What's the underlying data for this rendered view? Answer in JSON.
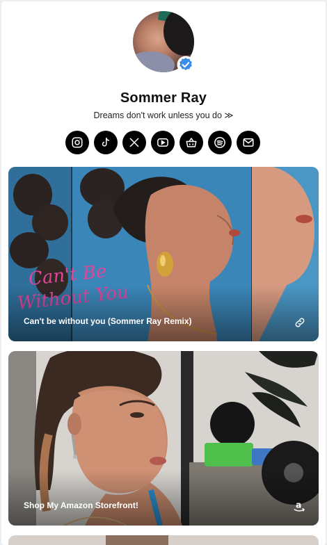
{
  "profile": {
    "name": "Sommer Ray",
    "bio": "Dreams don't work unless you do ≫"
  },
  "socials": [
    {
      "icon": "instagram-icon"
    },
    {
      "icon": "tiktok-icon"
    },
    {
      "icon": "x-icon"
    },
    {
      "icon": "youtube-icon"
    },
    {
      "icon": "shopping-basket-icon"
    },
    {
      "icon": "spotify-icon"
    },
    {
      "icon": "email-icon"
    }
  ],
  "links": [
    {
      "label": "Can't be without you (Sommer Ray Remix)",
      "icon": "link-icon",
      "artwork_text": "Can't Be Without You"
    },
    {
      "label": "Shop My Amazon Storefront!",
      "icon": "amazon-icon"
    }
  ],
  "colors": {
    "verified": "#3b8ee8",
    "card1_bg": "#3b86b8"
  }
}
